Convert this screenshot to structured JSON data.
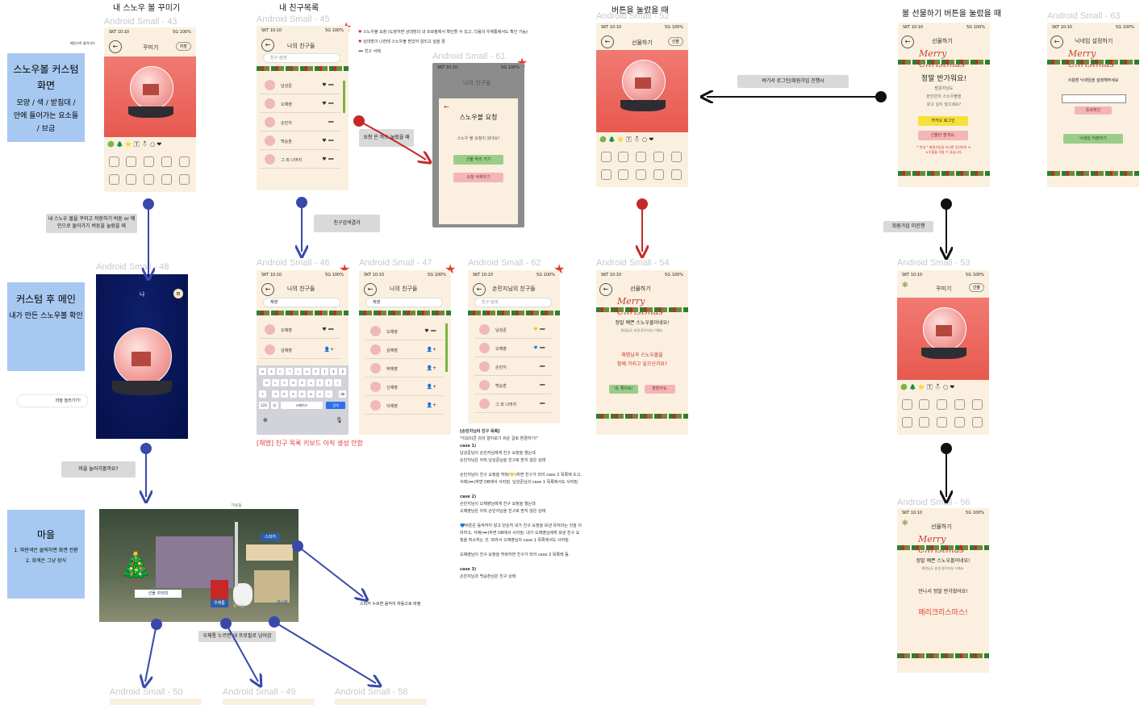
{
  "top_labels": {
    "l43": "내 스노우 볼 꾸미기",
    "l45": "내 친구목록",
    "l52": "버튼을 눌렀을 때",
    "l53": "볼 선물하기 버튼을 눌렀을 때"
  },
  "frames": {
    "f43": "Android Small - 43",
    "f45": "Android Small - 45",
    "f61": "Android Small - 61",
    "f52": "Android Small - 52",
    "f63": "Android Small - 63",
    "f48": "Android Small - 48",
    "f46": "Android Small - 46",
    "f47": "Android Small - 47",
    "f62": "Android Small - 62",
    "f54": "Android Small - 54",
    "f53": "Android Small - 53",
    "f56": "Android Small - 56",
    "f50": "Android Small - 50",
    "f49": "Android Small - 49",
    "f58": "Android Small - 58"
  },
  "status": {
    "time": "SKT 10:10",
    "signal": "5G 100%"
  },
  "p43": {
    "title": "꾸미기",
    "save": "저장",
    "side_note": "메인으로 돌아가기"
  },
  "blue1": {
    "title": "스노우볼 커스텀 화면",
    "desc": "모양 / 색 / 받침대 / 안에 들어가는 요소들 / 브금"
  },
  "flow1_btn": "내 스노우 볼을 꾸미고 저장하기 버튼 or 메인으로 돌아가기 버튼을 눌렀을 때",
  "p45": {
    "title": "나의 친구들",
    "search": "친구 검색",
    "friends": [
      "남성준",
      "오채영",
      "손민지",
      "백승훈",
      "그 외 나머지"
    ]
  },
  "legend": [
    "스노우볼 요청 (도장하면 상대방의 내 프로필에서 확인할 수 있고, 다음의 우체통에서도 확인 가능)",
    "상대방이 나한테 스노우볼 받았어 알리고 싶을 경",
    "친구 삭제"
  ],
  "req_label": "요청 온 하트 눌렀을 때",
  "p61": {
    "title": "나의 친구들",
    "modal_title": "스노우볼 요청",
    "modal_text": "스노우 볼 요청이 왔네요!",
    "accept": "선물 하러 가기",
    "delete": "요청 삭제하기"
  },
  "friend_search_btn": "친구검색결과",
  "p52": {
    "title": "선물하기",
    "btn": "선물"
  },
  "arrow_note": "여기서 로그인/회원가입 진행시",
  "p55": {
    "title": "선물하기",
    "heading": "정말 반가워요!",
    "line1": "방문자님도",
    "line2": "본인만의 스노우볼을",
    "line3": "갖고 싶지 않으세요?",
    "kakao": "카카오 로그인",
    "gift": "선물만 할게요.",
    "small": "* 안내 * 회원가입을 하시면 당신만의 스노우볼을 가질 수 있습니다."
  },
  "p63": {
    "title": "닉네임 설정하기",
    "text": "사용할 닉네임을 설정해주세요",
    "check": "중복확인",
    "btn": "닉네임 저장하기"
  },
  "signup_note": "회원가입 미진행",
  "p48": {
    "name": "나"
  },
  "blue2": {
    "title": "커스텀 후 메인",
    "desc": "내가 만든 스노우볼 확인"
  },
  "village_chip": "마을 놀러가기!",
  "village_btn": "마을 놀러가볼까요?",
  "blue3": {
    "title": "마을",
    "desc1": "1. 파란색은 클릭하면 화면 전환",
    "desc2": "2. 회색은 그냥 장식"
  },
  "village": {
    "top": "가로등",
    "speaker": "스피커",
    "gift": "선물 꾸러미",
    "post": "우체통",
    "snowman": "눈사람",
    "board": "게시판"
  },
  "speaker_note": "스피커 누르면 음악이 자동으로 바뀜",
  "post_note": "우체통 누르면 내 프로필로 넘어감",
  "p46": {
    "title": "나의 친구들",
    "search": "채영",
    "results": [
      "오채영",
      "김채영"
    ],
    "space": "스페이스",
    "go": "검색"
  },
  "p46_note": "[채명] 친구 목록 키보드 아직 생성 안함",
  "p47": {
    "title": "나의 친구들",
    "search": "채영",
    "results": [
      "오채영",
      "김채영",
      "박채영",
      "신채영",
      "이채영"
    ]
  },
  "p62": {
    "title": "손민지님의 친구들",
    "search": "친구 검색",
    "friends": [
      "남성준",
      "오채영",
      "손민지",
      "백승훈",
      "그 외 나머지"
    ]
  },
  "case_notes": [
    "[손민지님의 친구 목록]",
    "\"이모티콘 의미 알아보기 쉬운 걸로 변경하기!\"",
    "case 1)",
    "남성준님이 손민지님에게 친구 요청을 했는데",
    "손민지님은 아직 남성준님을 친구로 받지 않은 상태",
    "",
    "손민지님이 친구 요청을 허락(💛)하면 친구가 되어 case 3 목록에 뜨고,",
    "삭제(➖)하면 DB에서 사라짐. 남성준님의 case 1 목록에서도 사라짐",
    "",
    "case 2)",
    "손민지님이 오채영님에게 친구 요청을 했는데",
    "오채영님은 아직 손민지님을 친구로 받지 않은 상태",
    "",
    "💙버튼은 동작하지 않고 단순히 내가 친구 요청을 보낸 유저라는 것을 의",
    "미하고, 삭제(➖)하면 DB에서 사라짐. 내가 오채영님에게 보낸 친구 요",
    "청을 취소하는 것. 따라서 오채영님의 case 1 목록에서도 사라짐.",
    "",
    "오채영님이 친구 요청을 허락하면 친구가 되어 case 3 목록에 뜸.",
    "",
    "case 3)",
    "손민지님과 백승훈님은 친구 상태"
  ],
  "p54": {
    "title": "선물하기",
    "heading": "정말 예쁜 스노우볼이네요!",
    "sub": "채명님도 분명 좋아하실 거예요.",
    "q1": "채명님과 스노우볼을",
    "q2": "함께 가지고 싶으신가요?",
    "yes": "네, 좋아요!",
    "no": "괜찮아요."
  },
  "p53": {
    "title": "꾸미기",
    "btn": "선물"
  },
  "p56": {
    "title": "선물하기",
    "heading": "정말 예쁜 스노우볼이네요!",
    "sub": "채명님도 분명 좋아하실 거예요.",
    "meet": "만나서 정말 반가웠어요!",
    "merry": "메리크리스마스!"
  },
  "merry_text": "Merry Christmas"
}
